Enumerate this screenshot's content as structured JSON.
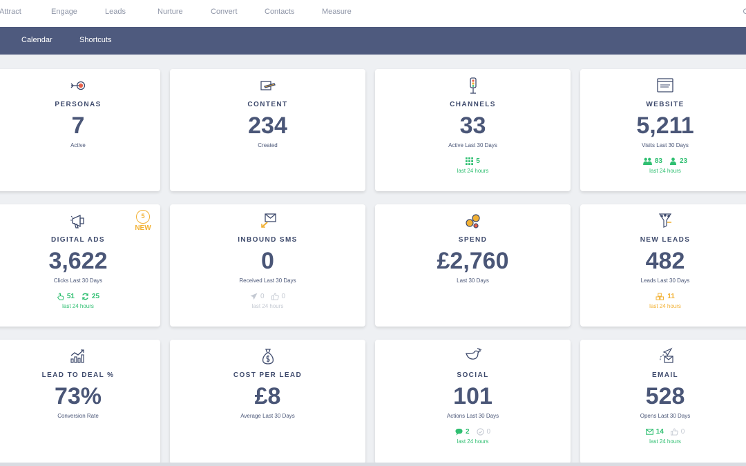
{
  "top_nav": {
    "items": [
      "Attract",
      "Engage",
      "Leads",
      "Nurture",
      "Convert",
      "Contacts",
      "Measure"
    ],
    "edge_text": "G"
  },
  "sub_nav": {
    "items": [
      "Calendar",
      "Shortcuts"
    ]
  },
  "colors": {
    "navy": "#4e5a7e",
    "text": "#4a5677",
    "green": "#2fbf71",
    "grey": "#c4c9d2",
    "orange": "#f2b134"
  },
  "cards": [
    {
      "title": "PERSONAS",
      "value": "7",
      "subtitle": "Active",
      "icon": "target-arrow-icon"
    },
    {
      "title": "CONTENT",
      "value": "234",
      "subtitle": "Created",
      "icon": "pencil-document-icon"
    },
    {
      "title": "CHANNELS",
      "value": "33",
      "subtitle": "Active Last 30 Days",
      "icon": "traffic-light-icon",
      "stats": [
        {
          "icon": "grid-icon",
          "value": "5"
        }
      ],
      "period": "last 24 hours"
    },
    {
      "title": "WEBSITE",
      "value": "5,211",
      "subtitle": "Visits Last 30 Days",
      "icon": "browser-window-icon",
      "stats": [
        {
          "icon": "users-icon",
          "value": "83"
        },
        {
          "icon": "user-icon",
          "value": "23"
        }
      ],
      "period": "last 24 hours"
    },
    {
      "title": "DIGITAL ADS",
      "value": "3,622",
      "subtitle": "Clicks Last 30 Days",
      "icon": "megaphone-icon",
      "badge": {
        "count": "5",
        "label": "NEW"
      },
      "stats": [
        {
          "icon": "pointer-hand-icon",
          "value": "51"
        },
        {
          "icon": "refresh-icon",
          "value": "25"
        }
      ],
      "period": "last 24 hours"
    },
    {
      "title": "INBOUND SMS",
      "value": "0",
      "subtitle": "Received Last 30 Days",
      "icon": "envelope-arrow-icon",
      "stats": [
        {
          "icon": "paper-plane-icon",
          "value": "0"
        },
        {
          "icon": "thumbs-up-icon",
          "value": "0"
        }
      ],
      "period": "last 24 hours"
    },
    {
      "title": "SPEND",
      "value": "£2,760",
      "subtitle": "Last 30 Days",
      "icon": "coins-icon"
    },
    {
      "title": "NEW LEADS",
      "value": "482",
      "subtitle": "Leads Last 30 Days",
      "icon": "funnel-people-icon",
      "stats": [
        {
          "icon": "cubes-icon",
          "value": "11"
        }
      ],
      "period": "last 24 hours"
    },
    {
      "title": "LEAD TO DEAL %",
      "value": "73%",
      "subtitle": "Conversion Rate",
      "icon": "growth-chart-icon"
    },
    {
      "title": "COST PER LEAD",
      "value": "£8",
      "subtitle": "Average Last 30 Days",
      "icon": "money-bag-icon"
    },
    {
      "title": "SOCIAL",
      "value": "101",
      "subtitle": "Actions Last 30 Days",
      "icon": "bird-icon",
      "stats": [
        {
          "icon": "comment-icon",
          "value": "2"
        },
        {
          "icon": "check-circle-icon",
          "value": "0"
        }
      ],
      "period": "last 24 hours"
    },
    {
      "title": "EMAIL",
      "value": "528",
      "subtitle": "Opens Last 30 Days",
      "icon": "send-envelope-icon",
      "stats": [
        {
          "icon": "envelope-icon",
          "value": "14"
        },
        {
          "icon": "thumbs-up-icon",
          "value": "0"
        }
      ],
      "period": "last 24 hours"
    }
  ]
}
